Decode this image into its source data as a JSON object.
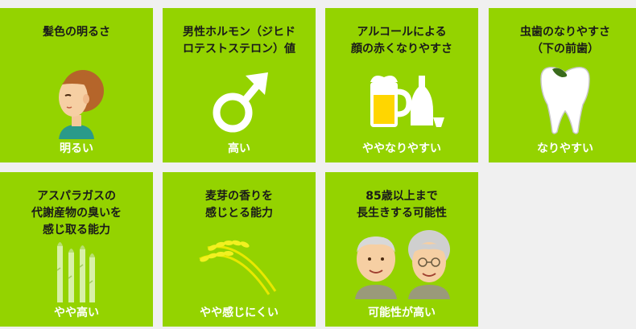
{
  "colors": {
    "card_bg": "#94d300",
    "page_bg": "#f0f0f0",
    "title_text": "#1a1a1a",
    "value_text": "#ffffff",
    "accent_dark_green": "#3a6b1c"
  },
  "cards": [
    {
      "title": "髪色の明るさ",
      "value": "明るい",
      "icon": "person-hair-icon"
    },
    {
      "title": "男性ホルモン（ジヒド\nロテストステロン）値",
      "value": "高い",
      "icon": "male-symbol-icon"
    },
    {
      "title": "アルコールによる\n顔の赤くなりやすさ",
      "value": "ややなりやすい",
      "icon": "beer-sake-icon"
    },
    {
      "title": "虫歯のなりやすさ\n（下の前歯）",
      "value": "なりやすい",
      "icon": "tooth-icon"
    },
    {
      "title": "アスパラガスの\n代謝産物の臭いを\n感じ取る能力",
      "value": "やや高い",
      "icon": "asparagus-icon"
    },
    {
      "title": "麦芽の香りを\n感じとる能力",
      "value": "やや感じにくい",
      "icon": "wheat-icon"
    },
    {
      "title": "85歳以上まで\n長生きする可能性",
      "value": "可能性が高い",
      "icon": "elderly-couple-icon"
    }
  ]
}
